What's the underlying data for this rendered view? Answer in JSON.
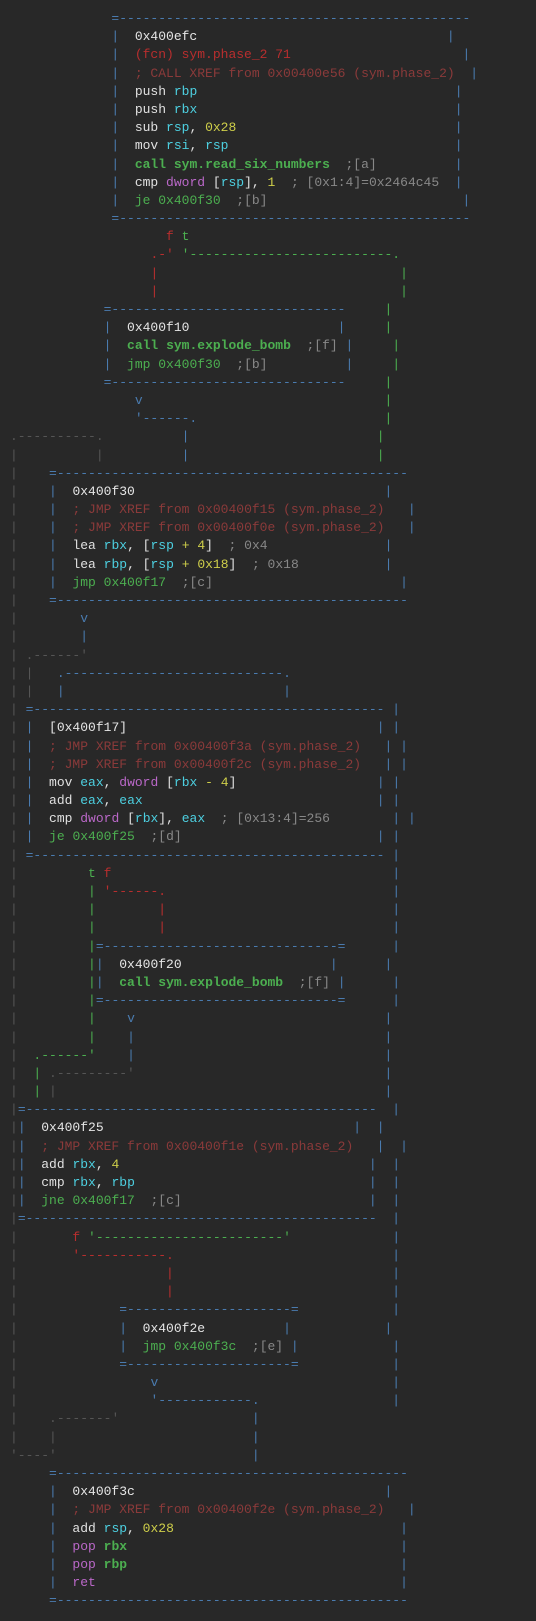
{
  "b1": {
    "addr": "0x400efc",
    "fn": "(fcn) sym.phase_2 71",
    "xref": "; CALL XREF from 0x00400e56 (sym.phase_2)",
    "l1_op": "push",
    "l1_r": "rbp",
    "l2_op": "push",
    "l2_r": "rbx",
    "l3_op": "sub",
    "l3_r": "rsp",
    "l3_c": ",",
    "l3_v": "0x28",
    "l4_op": "mov",
    "l4_r1": "rsi",
    "l4_c": ",",
    "l4_r2": "rsp",
    "l5_op": "call",
    "l5_fn": "sym.read_six_numbers",
    "l5_tag": ";[a]",
    "l6_op": "cmp",
    "l6_k": "dword",
    "l6_br": "[",
    "l6_r": "rsp",
    "l6_bc": "],",
    "l6_v": "1",
    "l6_note": "; [0x1:4]=0x2464c45",
    "l7_op": "je",
    "l7_t": "0x400f30",
    "l7_tag": ";[b]"
  },
  "ft1": "f t",
  "b2": {
    "addr": "0x400f10",
    "l1_op": "call",
    "l1_fn": "sym.explode_bomb",
    "l1_tag": ";[f]",
    "l2_op": "jmp",
    "l2_t": "0x400f30",
    "l2_tag": ";[b]"
  },
  "b3": {
    "addr": "0x400f30",
    "x1": "; JMP XREF from 0x00400f15 (sym.phase_2)",
    "x2": "; JMP XREF from 0x00400f0e (sym.phase_2)",
    "l1_op": "lea",
    "l1_r": "rbx",
    "l1_c": ", [",
    "l1_r2": "rsp",
    "l1_p": "+",
    "l1_v": "4",
    "l1_bc": "]",
    "l1_note": "; 0x4",
    "l2_op": "lea",
    "l2_r": "rbp",
    "l2_c": ", [",
    "l2_r2": "rsp",
    "l2_p": "+",
    "l2_v": "0x18",
    "l2_bc": "]",
    "l2_note": "; 0x18",
    "l3_op": "jmp",
    "l3_t": "0x400f17",
    "l3_tag": ";[c]"
  },
  "b4": {
    "addr": "[0x400f17]",
    "x1": "; JMP XREF from 0x00400f3a (sym.phase_2)",
    "x2": "; JMP XREF from 0x00400f2c (sym.phase_2)",
    "l1_op": "mov",
    "l1_r": "eax",
    "l1_c": ",",
    "l1_k": "dword",
    "l1_br": "[",
    "l1_r2": "rbx",
    "l1_m": "-",
    "l1_v": "4",
    "l1_bc": "]",
    "l2_op": "add",
    "l2_r1": "eax",
    "l2_c": ",",
    "l2_r2": "eax",
    "l3_op": "cmp",
    "l3_k": "dword",
    "l3_br": "[",
    "l3_r": "rbx",
    "l3_bc": "],",
    "l3_r2": "eax",
    "l3_note": "; [0x13:4]=256",
    "l4_op": "je",
    "l4_t": "0x400f25",
    "l4_tag": ";[d]"
  },
  "tf2": "t f",
  "b5": {
    "addr": "0x400f20",
    "l1_op": "call",
    "l1_fn": "sym.explode_bomb",
    "l1_tag": ";[f]"
  },
  "b6": {
    "addr": "0x400f25",
    "x1": "; JMP XREF from 0x00400f1e (sym.phase_2)",
    "l1_op": "add",
    "l1_r": "rbx",
    "l1_c": ",",
    "l1_v": "4",
    "l2_op": "cmp",
    "l2_r1": "rbx",
    "l2_c": ",",
    "l2_r2": "rbp",
    "l3_op": "jne",
    "l3_t": "0x400f17",
    "l3_tag": ";[c]"
  },
  "b7": {
    "addr": "0x400f2e",
    "l1_op": "jmp",
    "l1_t": "0x400f3c",
    "l1_tag": ";[e]"
  },
  "b8": {
    "addr": "0x400f3c",
    "x1": "; JMP XREF from 0x00400f2e (sym.phase_2)",
    "l1_op": "add",
    "l1_r": "rsp",
    "l1_c": ",",
    "l1_v": "0x28",
    "l2_op": "pop",
    "l2_r": "rbx",
    "l3_op": "pop",
    "l3_r": "rbp",
    "l4_op": "ret"
  }
}
